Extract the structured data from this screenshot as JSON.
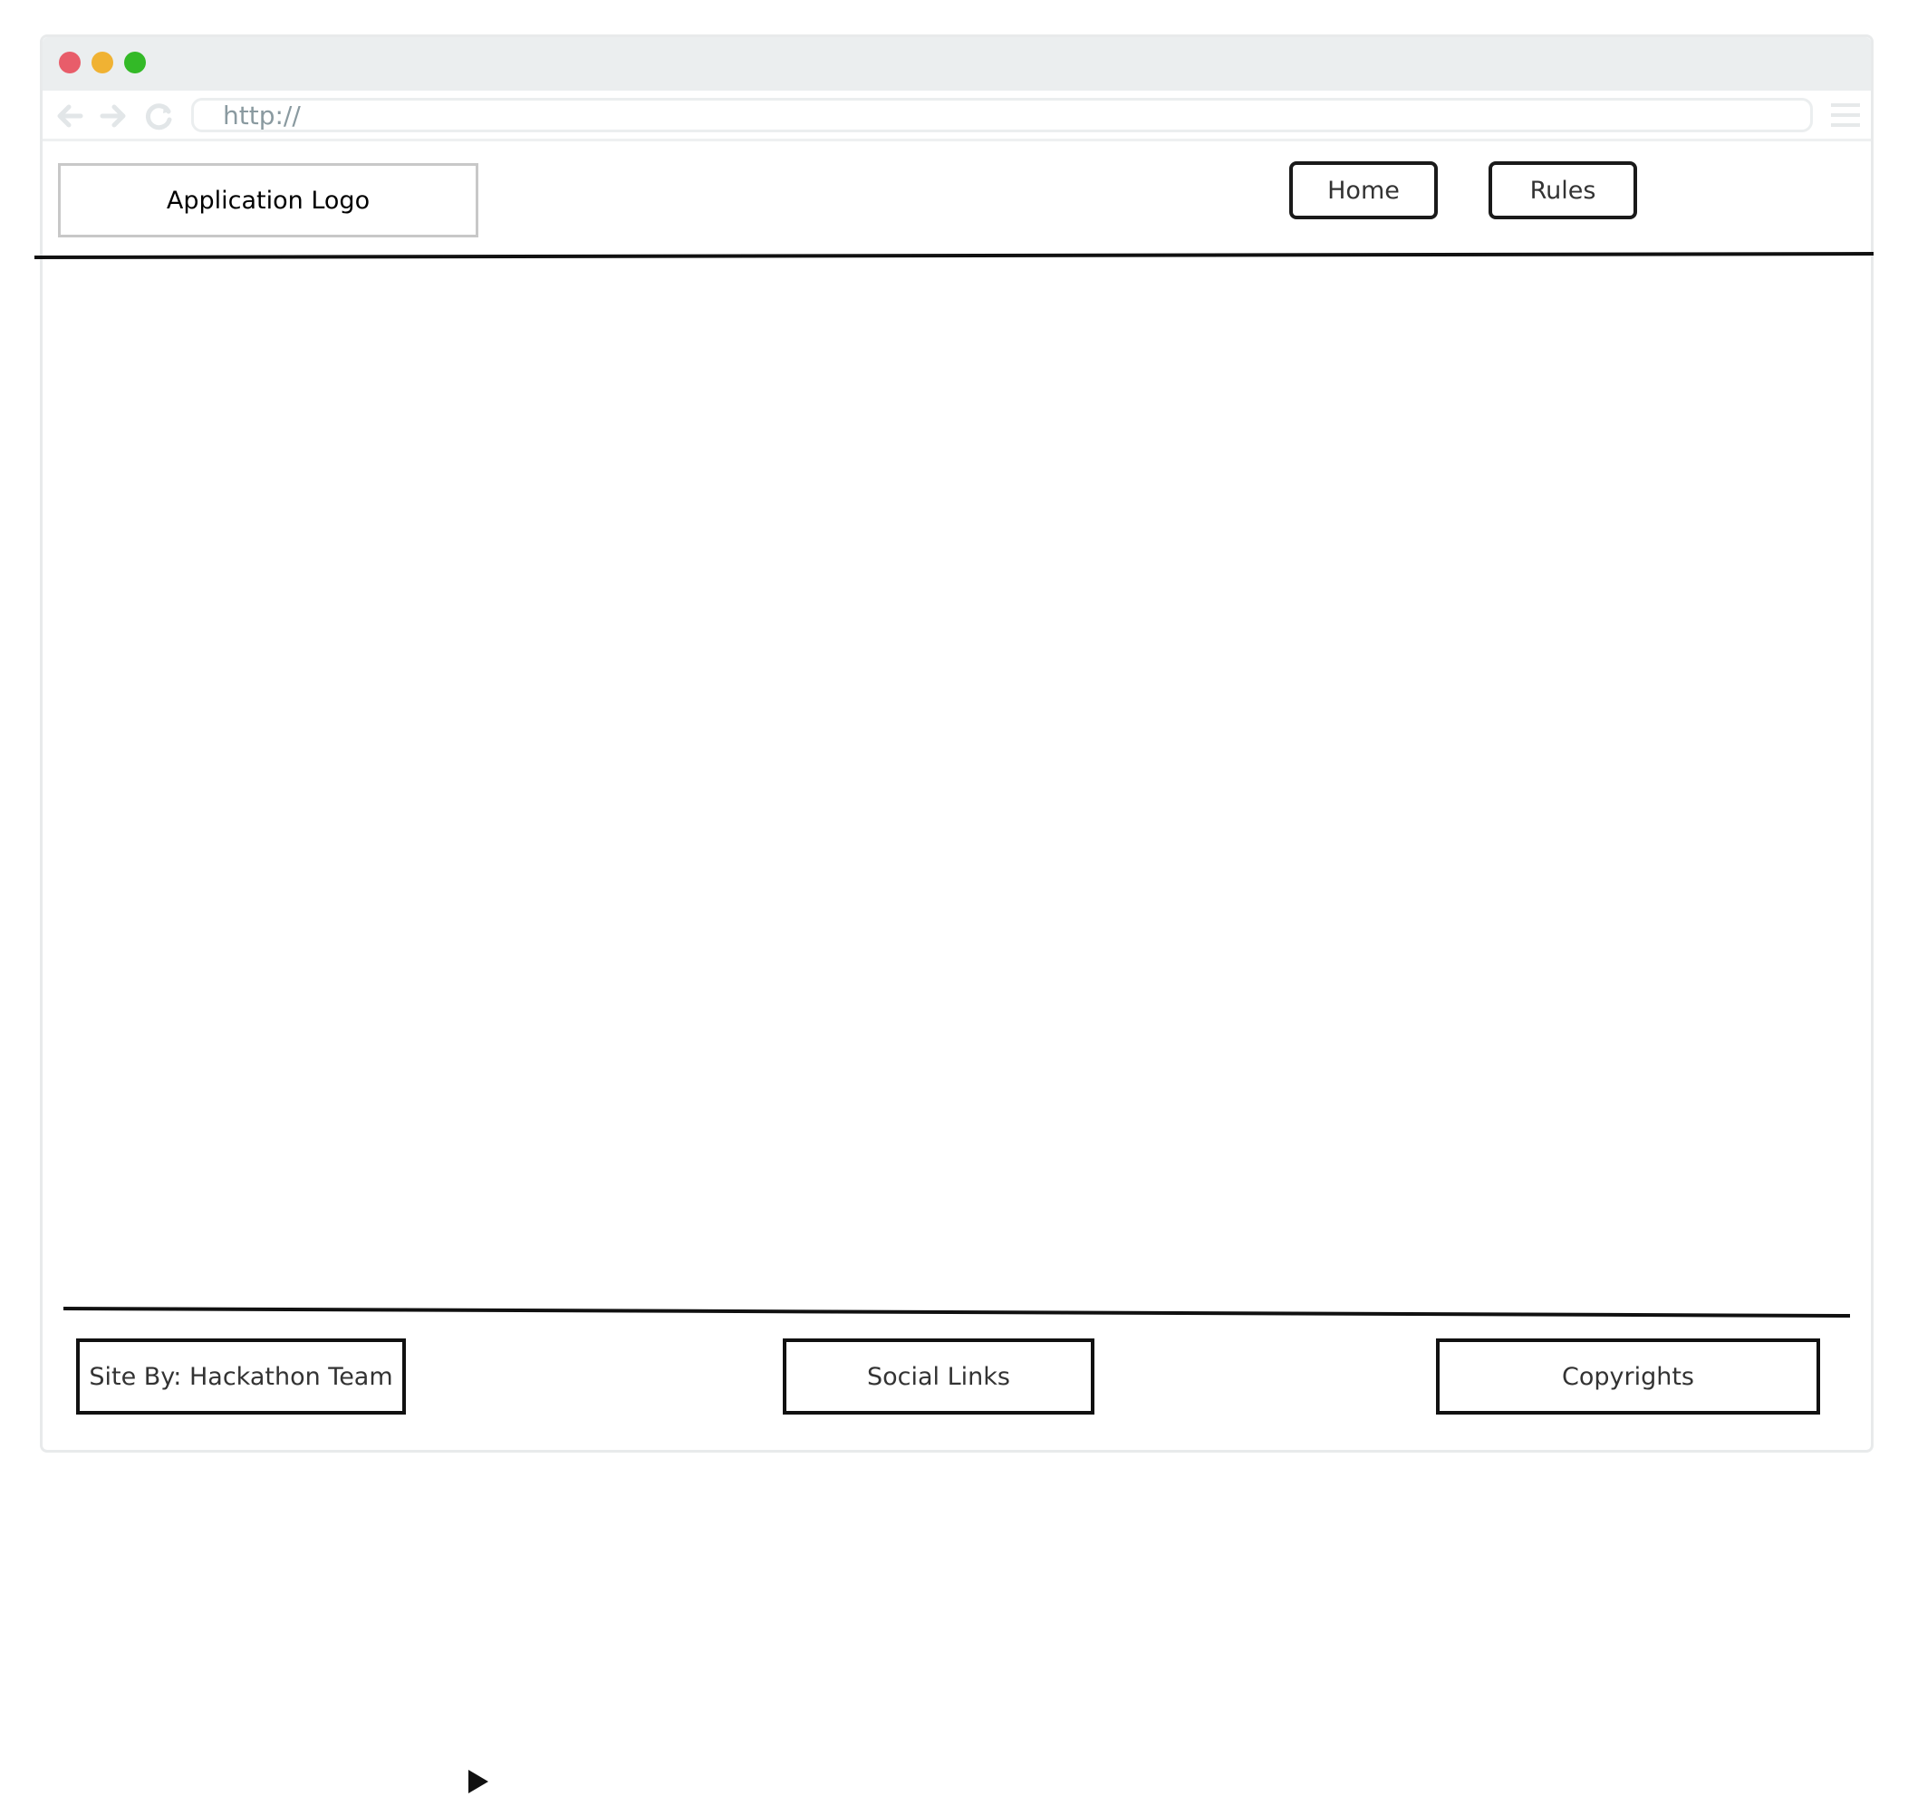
{
  "browser": {
    "url": "http://",
    "traffic_lights": {
      "close_color": "#e85d6a",
      "minimize_color": "#f0b233",
      "zoom_color": "#33b927"
    },
    "icons": [
      "back-arrow-icon",
      "forward-arrow-icon",
      "reload-icon",
      "hamburger-menu-icon"
    ]
  },
  "header": {
    "logo_label": "Application Logo",
    "nav": {
      "home_label": "Home",
      "rules_label": "Rules"
    }
  },
  "footer": {
    "site_by_label": "Site By: Hackathon Team",
    "social_links_label": "Social Links",
    "copyrights_label": "Copyrights"
  },
  "colors": {
    "chrome_bar": "#ebeeef",
    "wireframe_stroke": "#111111",
    "logo_border": "#c8c8c8"
  }
}
